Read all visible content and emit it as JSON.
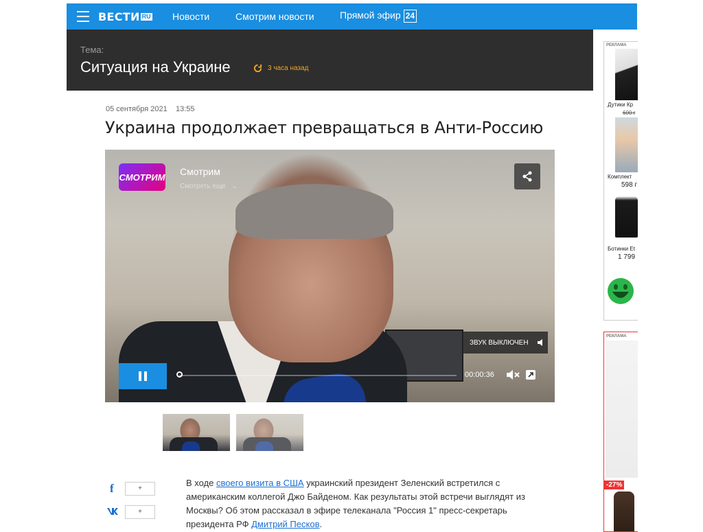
{
  "header": {
    "logo_text": "ВЕСТИ",
    "logo_ru": "RU",
    "nav": [
      "Новости",
      "Смотрим новости",
      "Прямой эфир"
    ],
    "live_badge": "24"
  },
  "theme": {
    "label": "Тема:",
    "title": "Ситуация на Украине",
    "updated": "3 часа назад"
  },
  "article": {
    "date": "05 сентября 2021",
    "time": "13:55",
    "title": "Украина продолжает превращаться в Анти-Россию",
    "body_before_link1": "В ходе ",
    "link1": "своего визита в США",
    "body_after_link1": " украинский президент Зеленский встретился с американским коллегой Джо Байденом. Как результаты этой встречи выглядят из Москвы? Об этом рассказал в эфире телеканала \"Россия 1\" пресс-секретарь президента РФ ",
    "link2": "Дмитрий Песков",
    "body_end": "."
  },
  "video": {
    "logo": "СМОТРИМ",
    "channel": "Смотрим",
    "more": "Смотреть еще",
    "sound_off": "ЗВУК ВЫКЛЮЧЕН",
    "current_time": "00:00:36",
    "progress": 0.0
  },
  "share": {
    "facebook": "f",
    "vk": "vk",
    "fb_count": "+",
    "vk_count": "+"
  },
  "ads": {
    "label": "РЕКЛАМА",
    "items": [
      {
        "name": "Дутики Кр",
        "old_price": "600 г",
        "price": ""
      },
      {
        "name": "Комплект",
        "old_price": "",
        "price": "598 г"
      },
      {
        "name": "Ботинки Et",
        "old_price": "",
        "price": "1 799"
      }
    ],
    "discount": "-27%"
  },
  "colors": {
    "accent": "#1a8ee0",
    "theme_bar": "#2e2e2e",
    "updated_orange": "#f5a623",
    "link": "#1a6fd0"
  }
}
